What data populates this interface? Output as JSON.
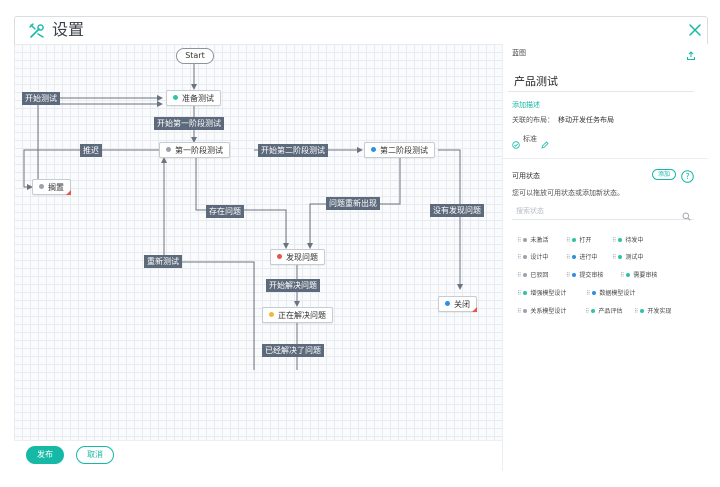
{
  "app": {
    "title": "设置",
    "colors": {
      "accent": "#15b9a6",
      "label_bg": "#5d6a7c",
      "gray_dot": "#9aa3ad",
      "green_dot": "#2ec4a6",
      "blue_dot": "#2f8fe0",
      "red_dot": "#e4554a",
      "yellow_dot": "#f0b93a"
    }
  },
  "workflow": {
    "start": "Start",
    "nodes": {
      "prepare": "准备测试",
      "shelved": "搁置",
      "phase1": "第一阶段测试",
      "phase2": "第二阶段测试",
      "found": "发现问题",
      "solving": "正在解决问题",
      "closed": "关闭"
    },
    "transitions": {
      "start_test": "开始测试",
      "begin_phase1": "开始第一阶段测试",
      "postpone": "推迟",
      "begin_phase2": "开始第二阶段测试",
      "has_issue": "存在问题",
      "issue_reappear": "问题重新出现",
      "no_issue": "没有发现问题",
      "retest": "重新测试",
      "start_solving": "开始解决问题",
      "solved": "已经解决了问题"
    }
  },
  "footer": {
    "publish": "发布",
    "cancel": "取消"
  },
  "panel": {
    "header": "蓝图",
    "flow_name": "产品测试",
    "add_description": "添加描述",
    "related_label": "关联的布局：",
    "related_value": "移动开发任务布局",
    "standard": "标准",
    "status_title": "可用状态",
    "add_button": "添加",
    "status_hint": "您可以拖放可用状态或添加新状态。",
    "search_placeholder": "搜索状态",
    "statuses": [
      {
        "label": "未激活",
        "color": "gray"
      },
      {
        "label": "打开",
        "color": "green"
      },
      {
        "label": "待发中",
        "color": "green"
      },
      {
        "label": "设计中",
        "color": "gray"
      },
      {
        "label": "进行中",
        "color": "blue"
      },
      {
        "label": "测试中",
        "color": "green"
      },
      {
        "label": "已驳回",
        "color": "gray"
      },
      {
        "label": "提交审核",
        "color": "blue"
      },
      {
        "label": "需要审核",
        "color": "green"
      },
      {
        "label": "增强模型设计",
        "color": "green"
      },
      {
        "label": "数据模型设计",
        "color": "blue"
      },
      {
        "label": "关系模型设计",
        "color": "gray"
      },
      {
        "label": "产品评估",
        "color": "green"
      },
      {
        "label": "开发实现",
        "color": "green"
      }
    ]
  }
}
